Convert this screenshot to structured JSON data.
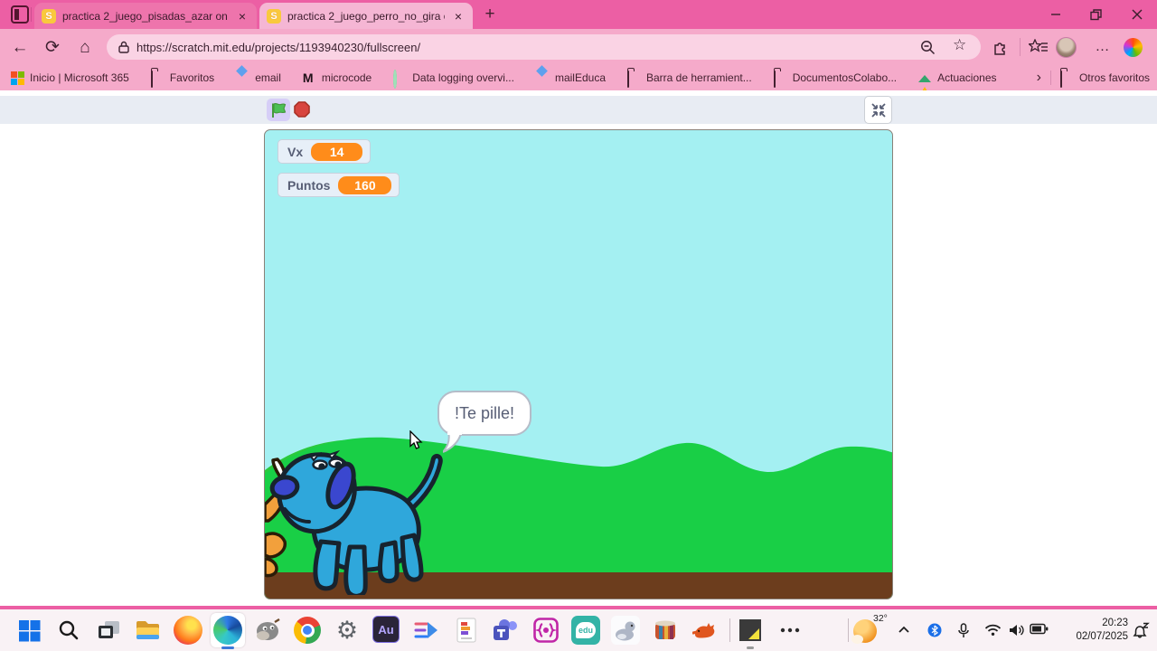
{
  "browser": {
    "tabs": [
      {
        "title": "practica 2_juego_pisadas_azar on"
      },
      {
        "title": "practica 2_juego_perro_no_gira o"
      }
    ],
    "url": "https://scratch.mit.edu/projects/1193940230/fullscreen/",
    "bookmarks": [
      {
        "label": "Inicio | Microsoft 365"
      },
      {
        "label": "Favoritos"
      },
      {
        "label": "email"
      },
      {
        "label": "microcode"
      },
      {
        "label": "Data logging overvi..."
      },
      {
        "label": "mailEduca"
      },
      {
        "label": "Barra de herramient..."
      },
      {
        "label": "DocumentosColabo..."
      },
      {
        "label": "Actuaciones"
      }
    ],
    "other_favorites": "Otros favoritos"
  },
  "player": {
    "monitors": [
      {
        "label": "Vx",
        "value": "14"
      },
      {
        "label": "Puntos",
        "value": "160"
      }
    ],
    "speech": "!Te pille!"
  },
  "taskbar": {
    "weather_temp": "32°",
    "time": "20:23",
    "date": "02/07/2025"
  },
  "icons": {
    "scratch_favicon": "S",
    "close_tab": "×",
    "new_tab": "+",
    "back": "←",
    "refresh": "⟳",
    "home": "⌂",
    "star": "☆",
    "more": "…",
    "bookmark_m": "M",
    "chevron_right": "›",
    "gear": "⚙",
    "audition": "Au",
    "edu": "edu"
  },
  "colors": {
    "titlebar": "#EC5FA4",
    "toolbar": "#F5AACA",
    "active_tab": "#F5B6D4",
    "inactive_tab": "#EE74AC",
    "monitor_value_bg": "#FF8C1A",
    "sky": "#A4F0F2",
    "bush_green": "#19CF46",
    "ground_brown": "#6C3D1D",
    "dog_body_blue": "#2FA7DB"
  }
}
